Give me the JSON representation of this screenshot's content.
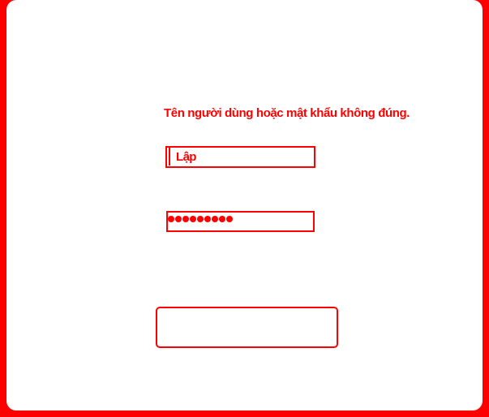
{
  "login": {
    "error_message": "Tên người dùng hoặc mật khẩu không đúng.",
    "username_value": "Lập",
    "password_mask_count": 9,
    "login_button_label": ""
  },
  "colors": {
    "accent": "#ff0000",
    "background": "#ffffff"
  }
}
